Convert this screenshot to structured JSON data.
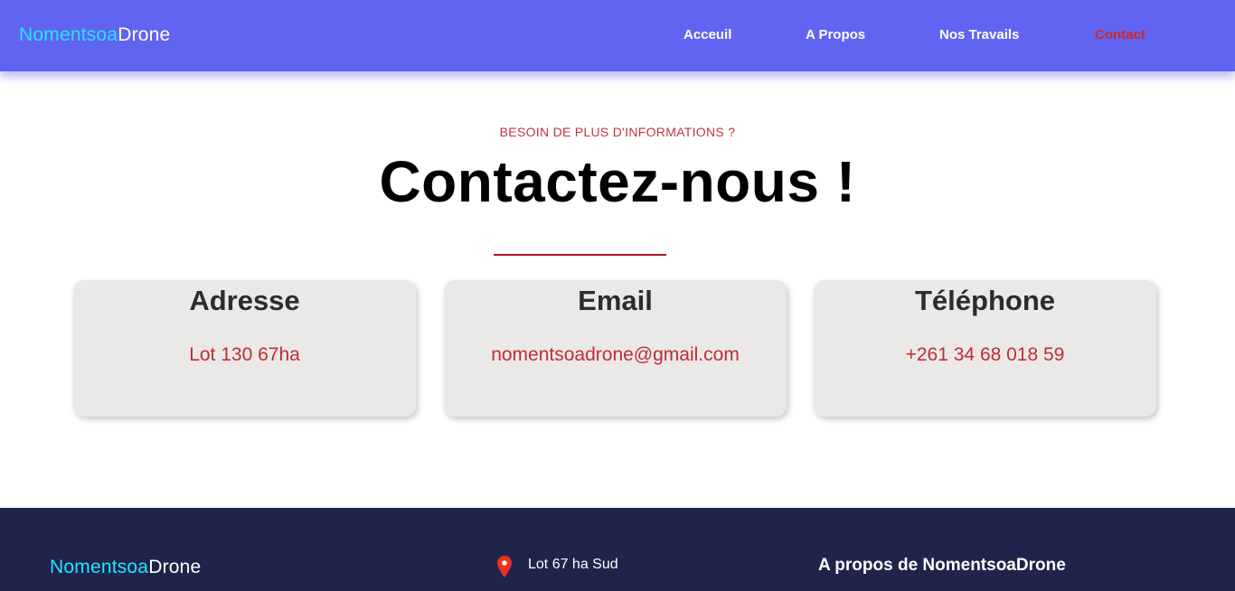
{
  "nav": {
    "brand_part1": "Nomentsoa",
    "brand_part2": "Drone",
    "links": [
      {
        "label": "Acceuil",
        "active": false
      },
      {
        "label": "A Propos",
        "active": false
      },
      {
        "label": "Nos Travails",
        "active": false
      },
      {
        "label": "Contact",
        "active": true
      }
    ]
  },
  "hero": {
    "eyebrow": "BESOIN DE PLUS D'INFORMATIONS ?",
    "title": "Contactez-nous !"
  },
  "cards": [
    {
      "title": "Adresse",
      "value": "Lot 130 67ha"
    },
    {
      "title": "Email",
      "value": "nomentsoadrone@gmail.com"
    },
    {
      "title": "Téléphone",
      "value": "+261 34 68 018 59"
    }
  ],
  "footer": {
    "brand_part1": "Nomentsoa",
    "brand_part2": "Drone",
    "address": "Lot 67 ha Sud",
    "about_heading": "A propos de NomentsoaDrone",
    "pin_icon": "map-pin-icon"
  },
  "colors": {
    "nav_bg": "#6164f0",
    "brand_accent": "#1fe6ff",
    "active_link": "#d42626",
    "accent_red": "#bf2d33",
    "card_bg": "#ebe9e7",
    "footer_bg": "#20234a"
  }
}
